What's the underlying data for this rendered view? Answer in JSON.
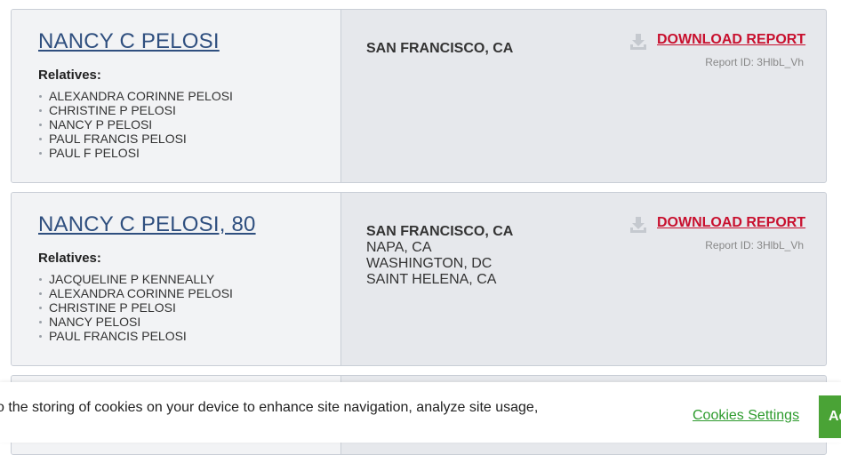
{
  "results": [
    {
      "name": "NANCY C PELOSI",
      "relatives_label": "Relatives:",
      "relatives": [
        "ALEXANDRA CORINNE PELOSI",
        "CHRISTINE P PELOSI",
        "NANCY P PELOSI",
        "PAUL FRANCIS PELOSI",
        "PAUL F PELOSI"
      ],
      "locations": [
        "SAN FRANCISCO, CA"
      ],
      "download_label": "DOWNLOAD REPORT",
      "report_id": "Report ID: 3HlbL_Vh"
    },
    {
      "name": "NANCY C PELOSI, 80",
      "relatives_label": "Relatives:",
      "relatives": [
        "JACQUELINE P KENNEALLY",
        "ALEXANDRA CORINNE PELOSI",
        "CHRISTINE P PELOSI",
        "NANCY PELOSI",
        "PAUL FRANCIS PELOSI"
      ],
      "locations": [
        "SAN FRANCISCO, CA",
        "NAPA, CA",
        "WASHINGTON, DC",
        "SAINT HELENA, CA"
      ],
      "download_label": "DOWNLOAD REPORT",
      "report_id": "Report ID: 3HlbL_Vh"
    }
  ],
  "cookie_banner": {
    "text": "o the storing of cookies on your device to enhance site navigation, analyze site usage,",
    "settings_label": "Cookies Settings",
    "accept_label": "Ac"
  },
  "icons": {
    "download": "download-icon"
  },
  "colors": {
    "link": "#2f4f7f",
    "download": "#c8102e",
    "accept": "#4aa336"
  }
}
